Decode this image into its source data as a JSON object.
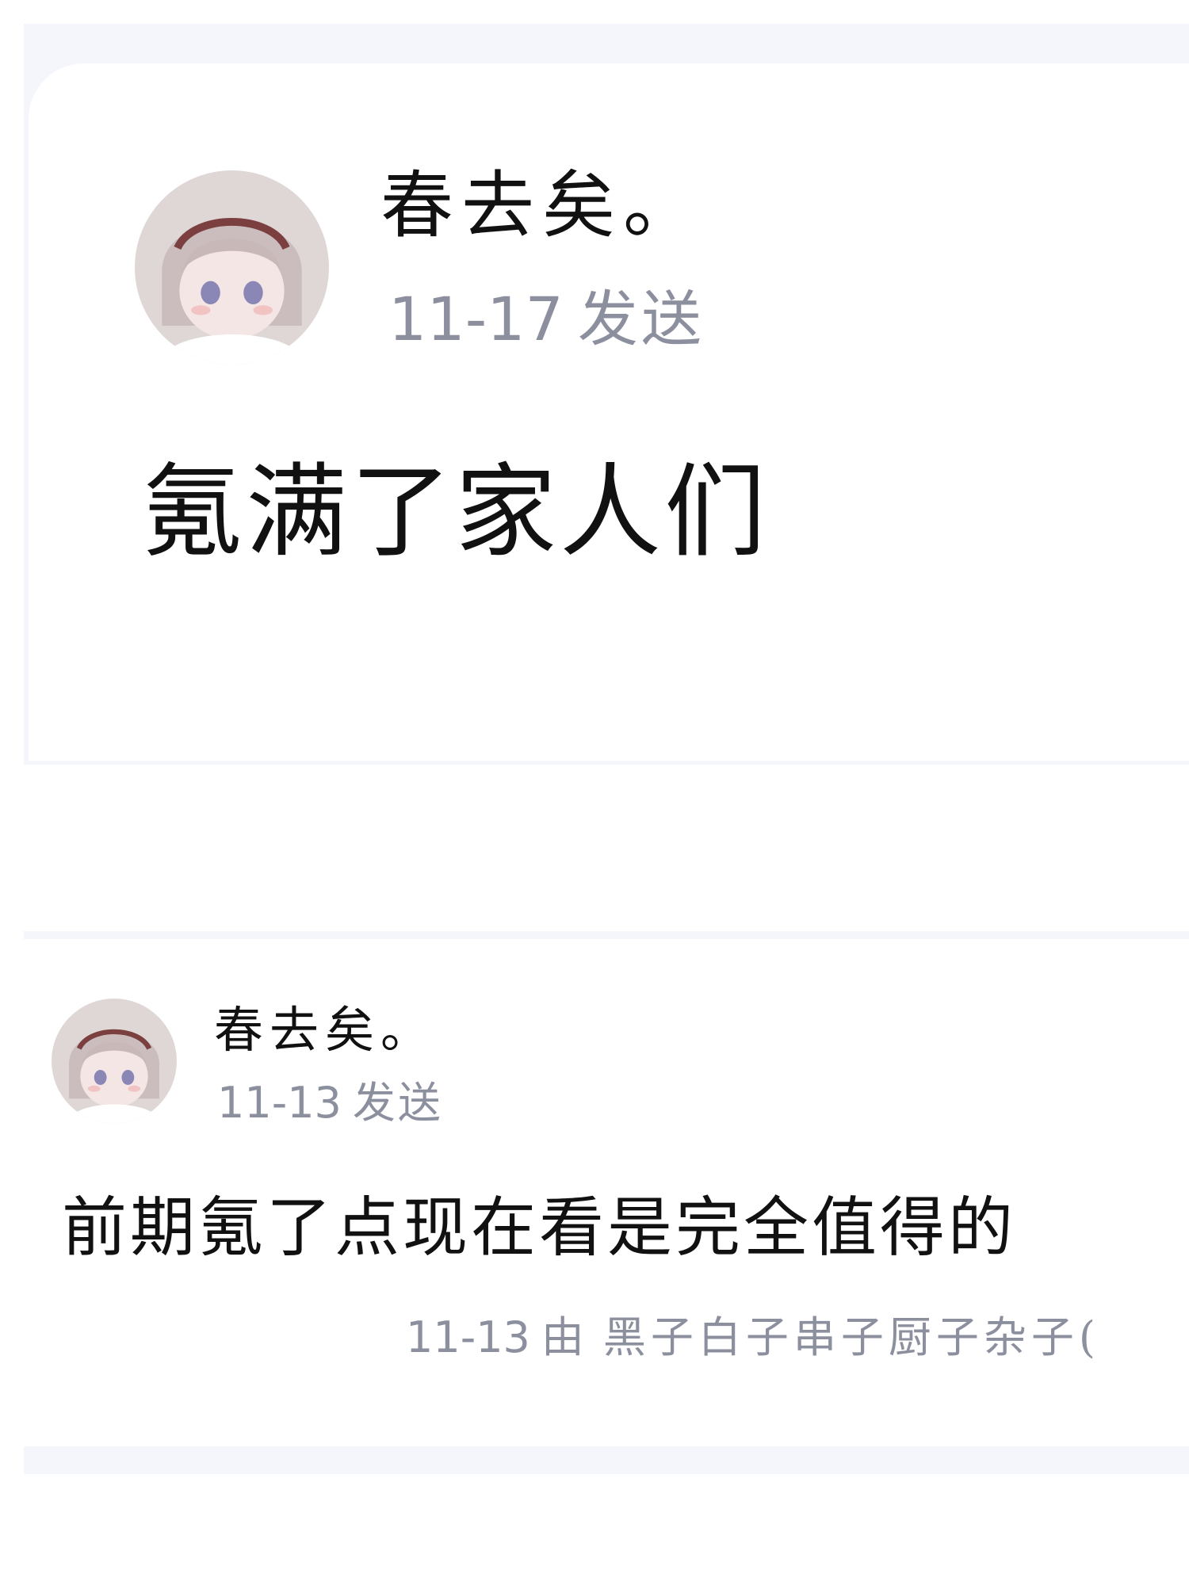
{
  "post_main": {
    "author": "春去矣。",
    "date": "11-17",
    "send_label": "发送",
    "content": "氪满了家人们"
  },
  "post_reply": {
    "author": "春去矣。",
    "date": "11-13",
    "send_label": "发送",
    "content": "前期氪了点现在看是完全值得的",
    "footer": {
      "date": "11-13",
      "by_label": "由",
      "users": "黑子白子串子厨子杂子("
    }
  },
  "colors": {
    "background_band": "#f5f6fb",
    "text_primary": "#111111",
    "text_secondary": "#8c8f9e"
  }
}
